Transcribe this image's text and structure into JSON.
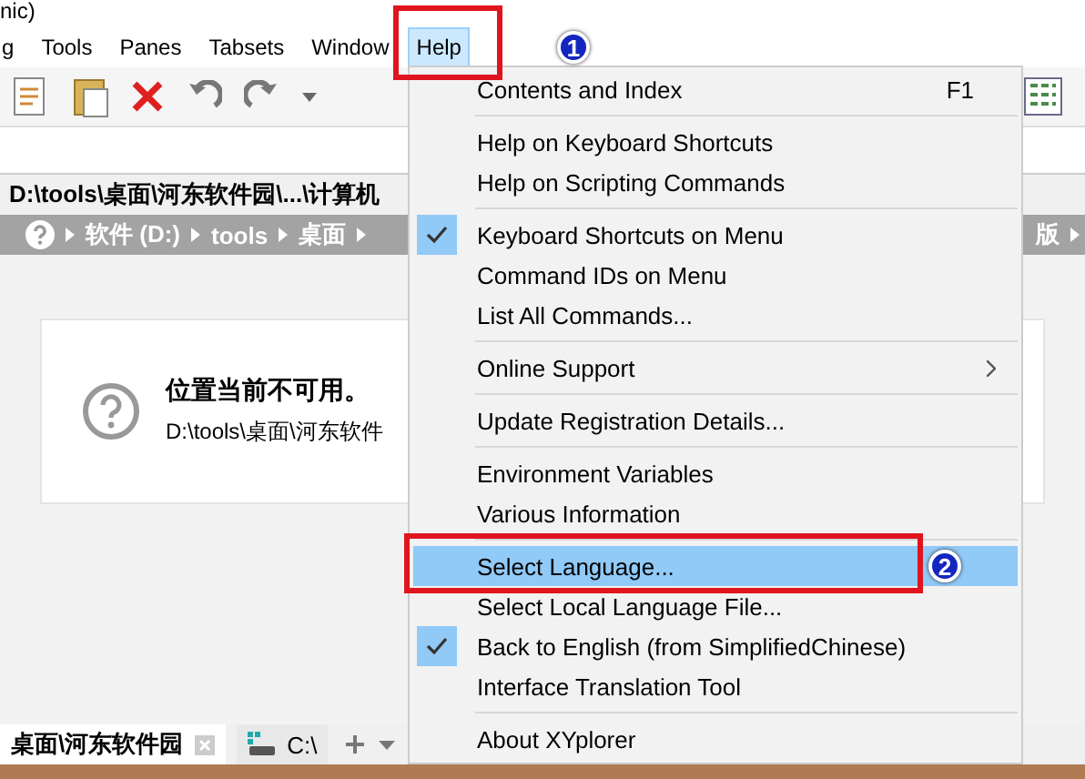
{
  "window": {
    "title": "nic)"
  },
  "menubar": [
    {
      "label": "g",
      "selected": false
    },
    {
      "label": "Tools",
      "selected": false
    },
    {
      "label": "Panes",
      "selected": false
    },
    {
      "label": "Tabsets",
      "selected": false
    },
    {
      "label": "Window",
      "selected": false
    },
    {
      "label": "Help",
      "selected": true
    }
  ],
  "path_header": "D:\\tools\\桌面\\河东软件园\\...\\计算机",
  "breadcrumb": {
    "segments": [
      "软件 (D:)",
      "tools",
      "桌面"
    ],
    "tail": "版"
  },
  "message": {
    "title": "位置当前不可用。",
    "path": "D:\\tools\\桌面\\河东软件"
  },
  "tabs": [
    {
      "label": "桌面\\河东软件园",
      "selected": true,
      "kind": "folder"
    },
    {
      "label": "C:\\",
      "selected": false,
      "kind": "drive"
    }
  ],
  "menu": {
    "groups": [
      [
        {
          "label": "Contents and Index",
          "shortcut": "F1",
          "checked": false,
          "selected": false
        }
      ],
      [
        {
          "label": "Help on Keyboard Shortcuts",
          "checked": false,
          "selected": false
        },
        {
          "label": "Help on Scripting Commands",
          "checked": false,
          "selected": false
        }
      ],
      [
        {
          "label": "Keyboard Shortcuts on Menu",
          "checked": true,
          "selected": false
        },
        {
          "label": "Command IDs on Menu",
          "checked": false,
          "selected": false
        },
        {
          "label": "List All Commands...",
          "checked": false,
          "selected": false
        }
      ],
      [
        {
          "label": "Online Support",
          "checked": false,
          "selected": false,
          "submenu": true
        }
      ],
      [
        {
          "label": "Update Registration Details...",
          "checked": false,
          "selected": false
        }
      ],
      [
        {
          "label": "Environment Variables",
          "checked": false,
          "selected": false
        },
        {
          "label": "Various Information",
          "checked": false,
          "selected": false
        }
      ],
      [
        {
          "label": "Select Language...",
          "checked": false,
          "selected": true
        },
        {
          "label": "Select Local Language File...",
          "checked": false,
          "selected": false
        },
        {
          "label": "Back to English (from SimplifiedChinese)",
          "checked": true,
          "selected": false
        },
        {
          "label": "Interface Translation Tool",
          "checked": false,
          "selected": false
        }
      ],
      [
        {
          "label": "About XYplorer",
          "checked": false,
          "selected": false
        }
      ]
    ]
  },
  "annotations": [
    {
      "label": "1"
    },
    {
      "label": "2"
    }
  ]
}
